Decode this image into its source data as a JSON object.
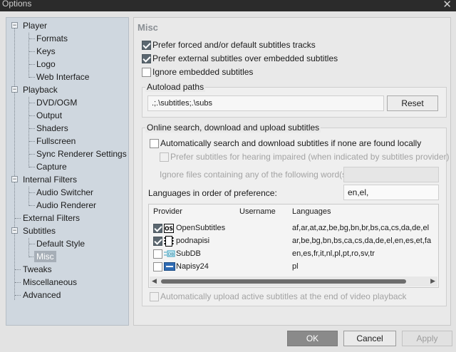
{
  "window": {
    "title": "Options",
    "close_glyph": "✕"
  },
  "tree": {
    "items": [
      {
        "label": "Player",
        "level": 0,
        "expanded": true
      },
      {
        "label": "Formats",
        "level": 1
      },
      {
        "label": "Keys",
        "level": 1
      },
      {
        "label": "Logo",
        "level": 1
      },
      {
        "label": "Web Interface",
        "level": 1
      },
      {
        "label": "Playback",
        "level": 0,
        "expanded": true
      },
      {
        "label": "DVD/OGM",
        "level": 1
      },
      {
        "label": "Output",
        "level": 1
      },
      {
        "label": "Shaders",
        "level": 1
      },
      {
        "label": "Fullscreen",
        "level": 1
      },
      {
        "label": "Sync Renderer Settings",
        "level": 1
      },
      {
        "label": "Capture",
        "level": 1
      },
      {
        "label": "Internal Filters",
        "level": 0,
        "expanded": true
      },
      {
        "label": "Audio Switcher",
        "level": 1
      },
      {
        "label": "Audio Renderer",
        "level": 1
      },
      {
        "label": "External Filters",
        "level": 0
      },
      {
        "label": "Subtitles",
        "level": 0,
        "expanded": true
      },
      {
        "label": "Default Style",
        "level": 1
      },
      {
        "label": "Misc",
        "level": 1,
        "selected": true
      },
      {
        "label": "Tweaks",
        "level": 0
      },
      {
        "label": "Miscellaneous",
        "level": 0
      },
      {
        "label": "Advanced",
        "level": 0
      }
    ],
    "expand_glyph": "−"
  },
  "panel": {
    "heading": "Misc",
    "prefer_forced": {
      "label": "Prefer forced and/or default subtitles tracks",
      "checked": true
    },
    "prefer_external": {
      "label": "Prefer external subtitles over embedded subtitles",
      "checked": true
    },
    "ignore_embedded": {
      "label": "Ignore embedded subtitles",
      "checked": false
    },
    "autoload": {
      "title": "Autoload paths",
      "value": ".;.\\subtitles;.\\subs",
      "reset_label": "Reset"
    },
    "online": {
      "title": "Online search, download and upload subtitles",
      "auto_search": {
        "label": "Automatically search and download subtitles if none are found locally",
        "checked": false
      },
      "hearing_impaired": {
        "label": "Prefer subtitles for hearing impaired (when indicated by subtitles provider)",
        "checked": false
      },
      "ignore_words_label": "Ignore files containing any of the following word(s):",
      "ignore_words_value": "",
      "languages_label": "Languages in order of preference:",
      "languages_value": "en,el,",
      "columns": [
        "Provider",
        "Username",
        "Languages"
      ],
      "providers": [
        {
          "name": "OpenSubtitles",
          "username": "",
          "languages": "af,ar,at,az,be,bg,bn,br,bs,ca,cs,da,de,el",
          "checked": true,
          "icon": "opensubtitles-icon"
        },
        {
          "name": "podnapisi",
          "username": "",
          "languages": "ar,be,bg,bn,bs,ca,cs,da,de,el,en,es,et,fa",
          "checked": true,
          "icon": "podnapisi-icon"
        },
        {
          "name": "SubDB",
          "username": "",
          "languages": "en,es,fr,it,nl,pl,pt,ro,sv,tr",
          "checked": false,
          "icon": "subdb-icon"
        },
        {
          "name": "Napisy24",
          "username": "",
          "languages": "pl",
          "checked": false,
          "icon": "napisy24-icon"
        }
      ],
      "auto_upload": {
        "label": "Automatically upload active subtitles at the end of video playback",
        "checked": false
      }
    }
  },
  "buttons": {
    "ok": "OK",
    "cancel": "Cancel",
    "apply": "Apply"
  },
  "colors": {
    "accent": "#5b6770",
    "tree_bg": "#cfd7df",
    "selected_bg": "#a6aeb7"
  }
}
